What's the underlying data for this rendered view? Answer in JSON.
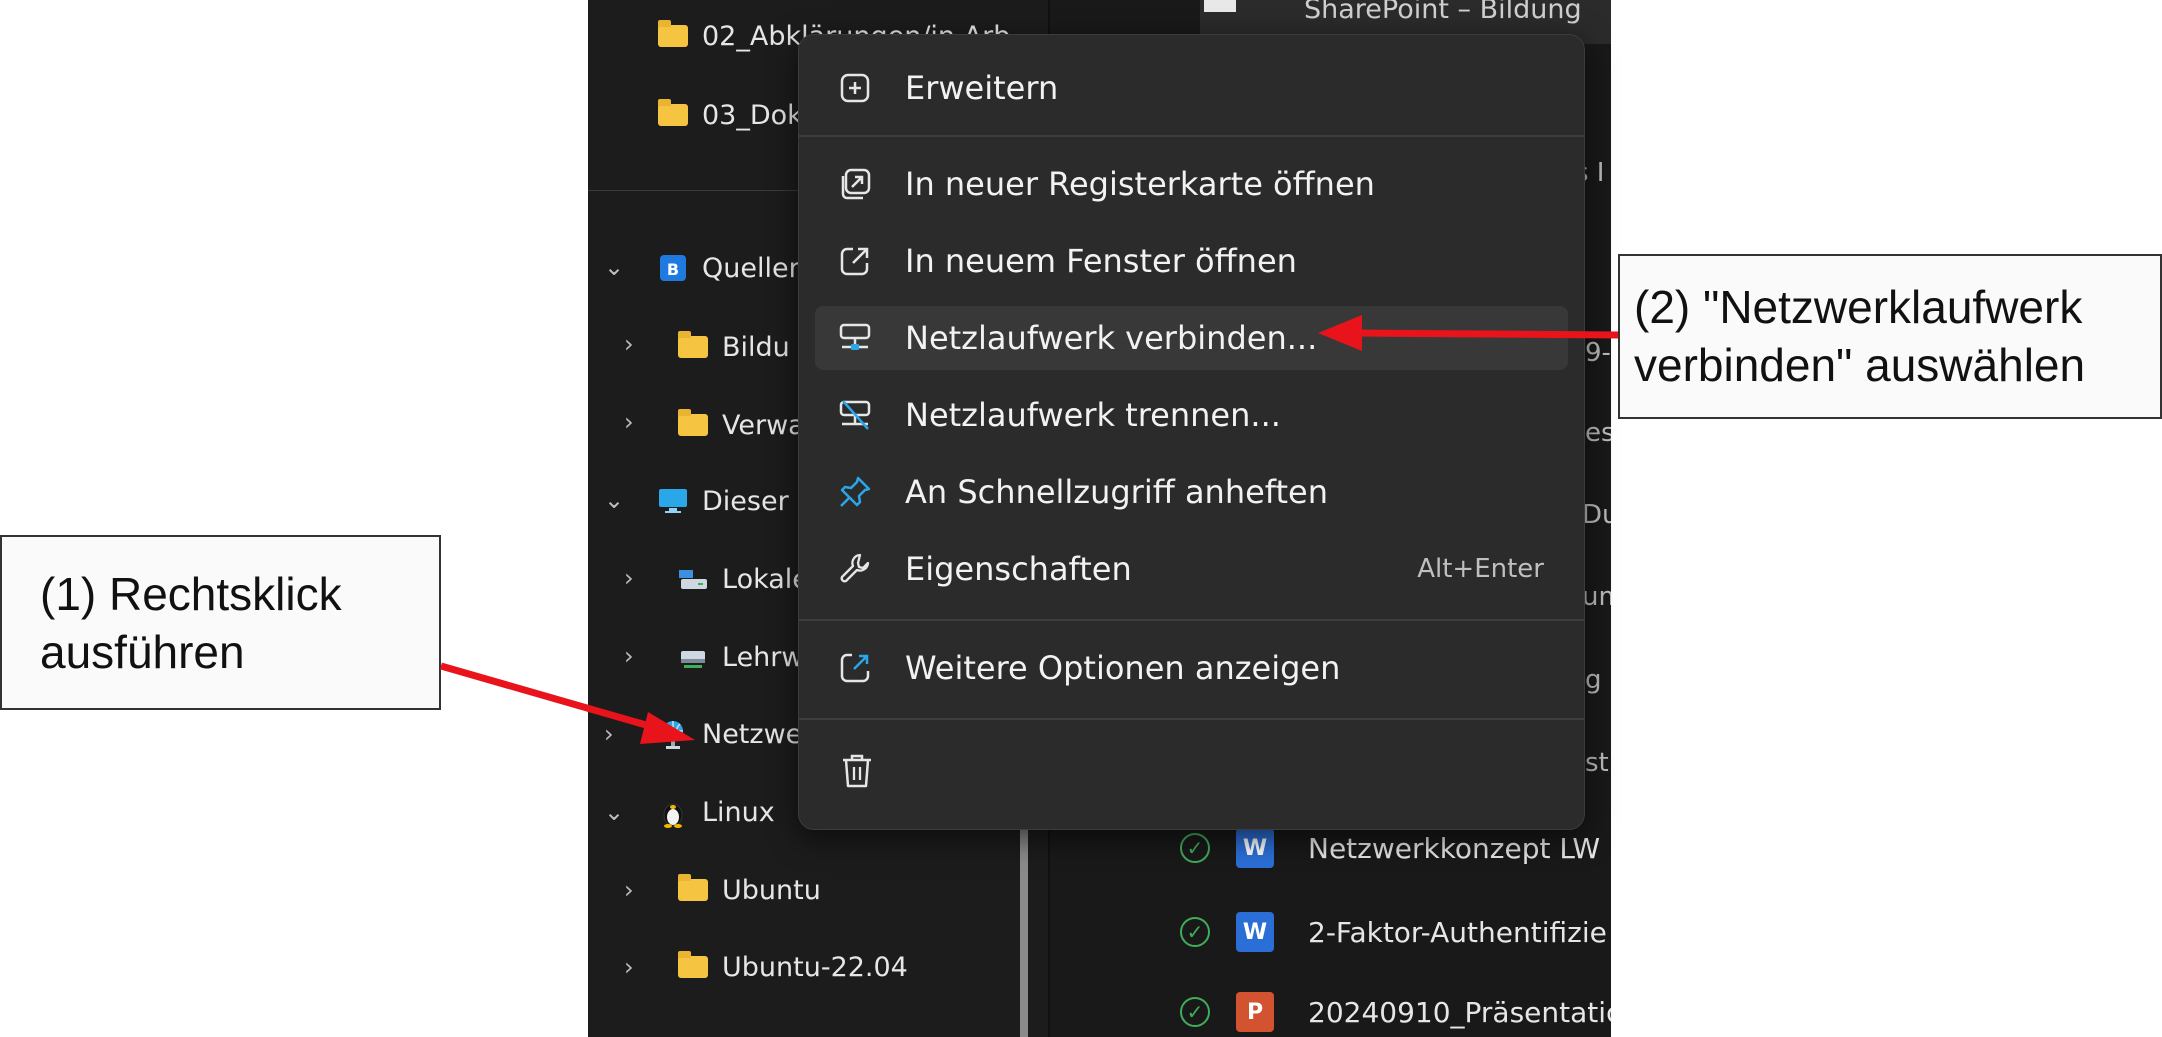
{
  "nav": {
    "items": [
      {
        "label": "02_Abklärungen/in Arb"
      },
      {
        "label": "03_Dok"
      },
      {
        "label": "Queller"
      },
      {
        "label": "Bildu"
      },
      {
        "label": "Verwa"
      },
      {
        "label": "Dieser I"
      },
      {
        "label": "Lokale"
      },
      {
        "label": "Lehrw"
      },
      {
        "label": "Netzwe"
      },
      {
        "label": "Linux"
      },
      {
        "label": "Ubuntu"
      },
      {
        "label": "Ubuntu-22.04"
      }
    ]
  },
  "content": {
    "top_label": "SharePoint – Bildung",
    "partials": [
      "s I",
      "9-",
      "ess",
      "Dut",
      "um",
      "g",
      "st"
    ],
    "files": [
      {
        "name": "Netzwerkkonzept LW",
        "badge": "W"
      },
      {
        "name": "2-Faktor-Authentifizie",
        "badge": "W"
      },
      {
        "name": "20240910_Präsentatic",
        "badge": "P"
      }
    ]
  },
  "context_menu": {
    "expand": "Erweitern",
    "open_new_tab": "In neuer Registerkarte öffnen",
    "open_new_window": "In neuem Fenster öffnen",
    "map_network_drive": "Netzlaufwerk verbinden...",
    "disconnect_network_drive": "Netzlaufwerk trennen...",
    "pin_quick_access": "An Schnellzugriff anheften",
    "properties": "Eigenschaften",
    "properties_shortcut": "Alt+Enter",
    "more_options": "Weitere Optionen anzeigen"
  },
  "annotations": {
    "step1_line1": "(1) Rechtsklick",
    "step1_line2": "ausführen",
    "step2_line1": "(2) \"Netzwerklaufwerk",
    "step2_line2": "verbinden\" auswählen",
    "arrow_color": "#e8131b"
  }
}
